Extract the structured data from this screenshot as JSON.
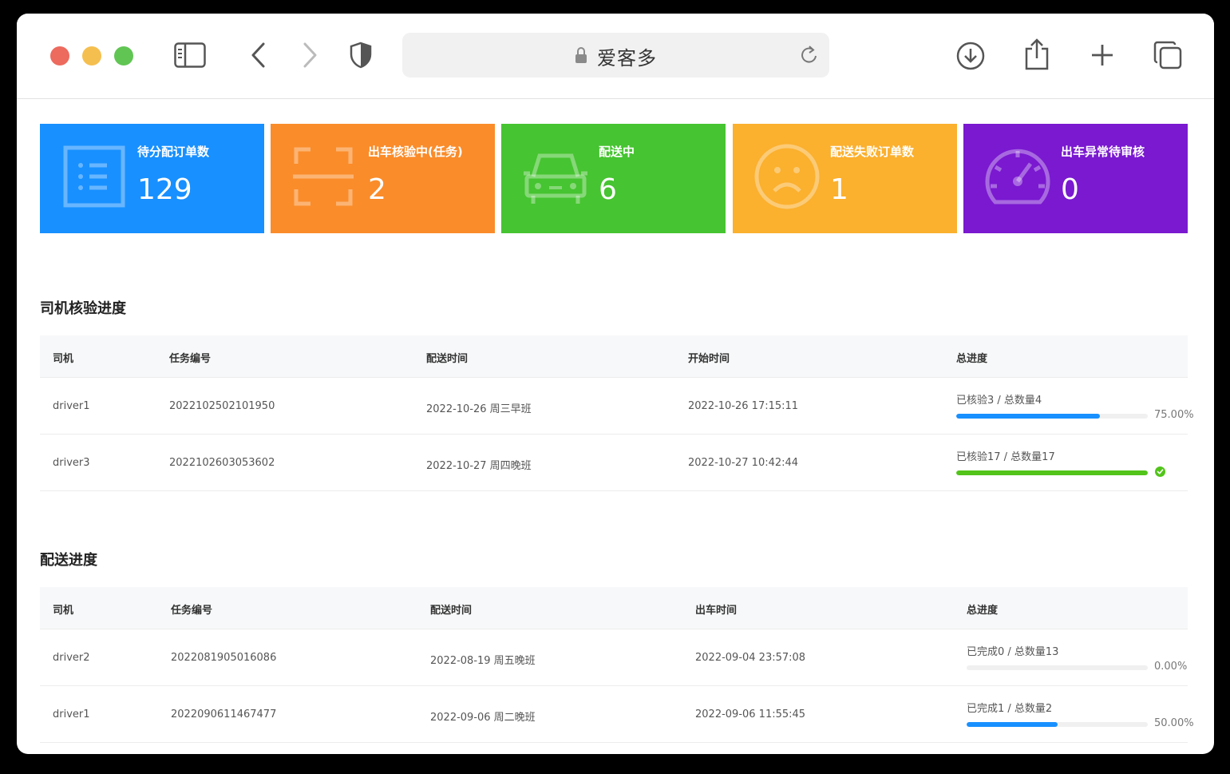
{
  "browser": {
    "address": "爱客多",
    "colors": {
      "close": "#ed6a5e",
      "minimize": "#f5bf4f",
      "zoom": "#61c554"
    },
    "icons": [
      "sidebar-icon",
      "back-icon",
      "forward-icon",
      "shield-icon",
      "lock-icon",
      "reload-icon",
      "download-icon",
      "share-icon",
      "new-tab-icon",
      "tabs-overview-icon"
    ]
  },
  "cards": [
    {
      "title": "待分配订单数",
      "value": "129",
      "color": "#1890ff",
      "icon": "list-icon"
    },
    {
      "title": "出车核验中(任务)",
      "value": "2",
      "color": "#fa8c2a",
      "icon": "scan-icon"
    },
    {
      "title": "配送中",
      "value": "6",
      "color": "#46c431",
      "icon": "car-icon"
    },
    {
      "title": "配送失败订单数",
      "value": "1",
      "color": "#fbb02e",
      "icon": "sad-face-icon"
    },
    {
      "title": "出车异常待审核",
      "value": "0",
      "color": "#7a19d0",
      "icon": "speedometer-icon"
    }
  ],
  "driver_check": {
    "title": "司机核验进度",
    "headers": [
      "司机",
      "任务编号",
      "配送时间",
      "开始时间",
      "总进度"
    ],
    "rows": [
      {
        "driver": "driver1",
        "task_no": "2022102502101950",
        "delivery_time": "2022-10-26 周三早班",
        "start_time": "2022-10-26 17:15:11",
        "progress_label": "已核验3 / 总数量4",
        "progress": 0.75,
        "progress_text": "75.00%",
        "status": "active"
      },
      {
        "driver": "driver3",
        "task_no": "2022102603053602",
        "delivery_time": "2022-10-27 周四晚班",
        "start_time": "2022-10-27 10:42:44",
        "progress_label": "已核验17 / 总数量17",
        "progress": 1.0,
        "progress_text": "",
        "status": "success"
      }
    ]
  },
  "delivery": {
    "title": "配送进度",
    "headers": [
      "司机",
      "任务编号",
      "配送时间",
      "出车时间",
      "总进度"
    ],
    "rows": [
      {
        "driver": "driver2",
        "task_no": "2022081905016086",
        "delivery_time": "2022-08-19 周五晚班",
        "depart_time": "2022-09-04 23:57:08",
        "progress_label": "已完成0 / 总数量13",
        "progress": 0.0,
        "progress_text": "0.00%"
      },
      {
        "driver": "driver1",
        "task_no": "2022090611467477",
        "delivery_time": "2022-09-06 周二晚班",
        "depart_time": "2022-09-06 11:55:45",
        "progress_label": "已完成1 / 总数量2",
        "progress": 0.5,
        "progress_text": "50.00%"
      }
    ]
  }
}
